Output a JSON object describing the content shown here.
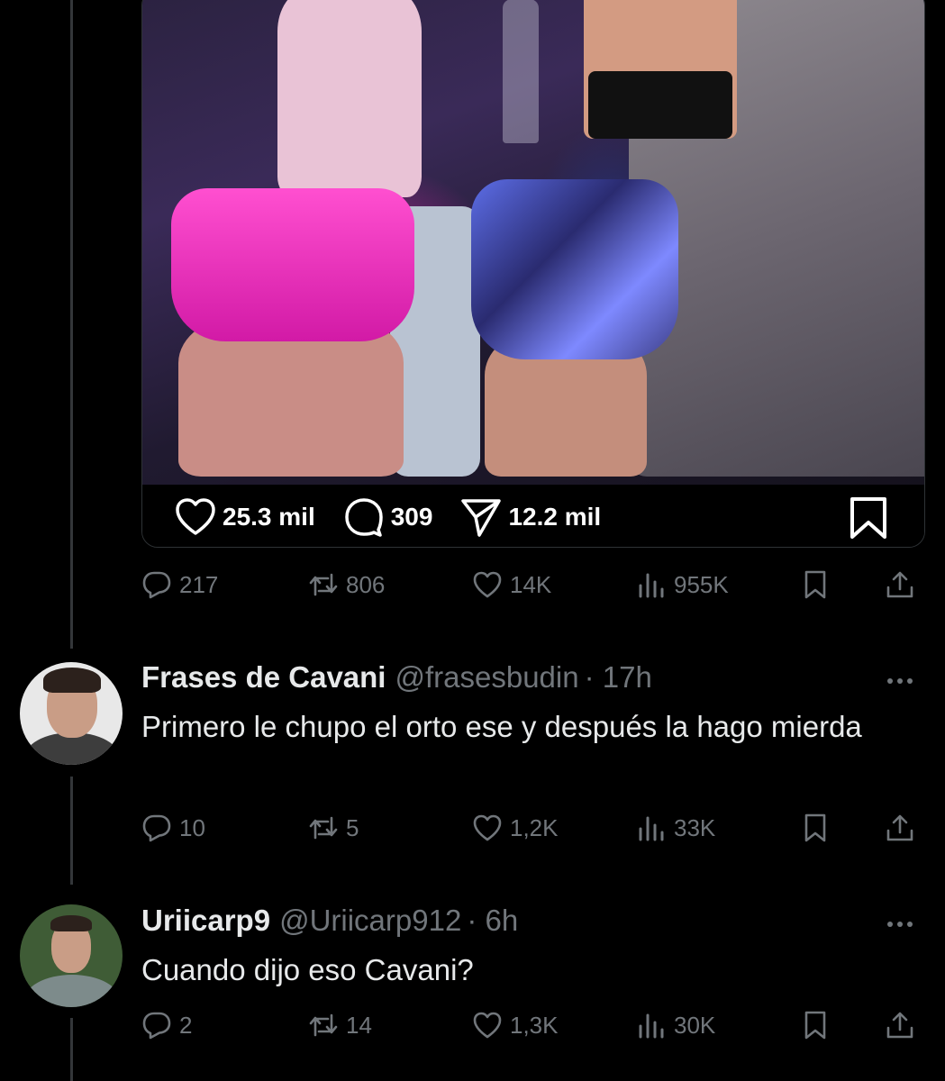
{
  "post": {
    "embed_stats": {
      "likes": "25.3 mil",
      "comments": "309",
      "shares": "12.2 mil"
    },
    "stats": {
      "replies": "217",
      "reposts": "806",
      "likes": "14K",
      "views": "955K"
    }
  },
  "replies": [
    {
      "name": "Frases de Cavani",
      "handle": "@frasesbudin",
      "time": "· 17h",
      "text": "Primero le chupo el orto ese y después la hago mierda",
      "stats": {
        "replies": "10",
        "reposts": "5",
        "likes": "1,2K",
        "views": "33K"
      }
    },
    {
      "name": "Uriicarp9",
      "handle": "@Uriicarp912",
      "time": "· 6h",
      "text": "Cuando dijo eso Cavani?",
      "stats": {
        "replies": "2",
        "reposts": "14",
        "likes": "1,3K",
        "views": "30K"
      }
    }
  ],
  "colors": {
    "background": "#000000",
    "text": "#e7e9ea",
    "muted": "#71767b",
    "divider": "#333639"
  },
  "icons": [
    "heart-icon",
    "comment-icon",
    "share-icon",
    "bookmark-icon",
    "reply-icon",
    "repost-icon",
    "views-icon",
    "upload-icon",
    "more-icon"
  ]
}
